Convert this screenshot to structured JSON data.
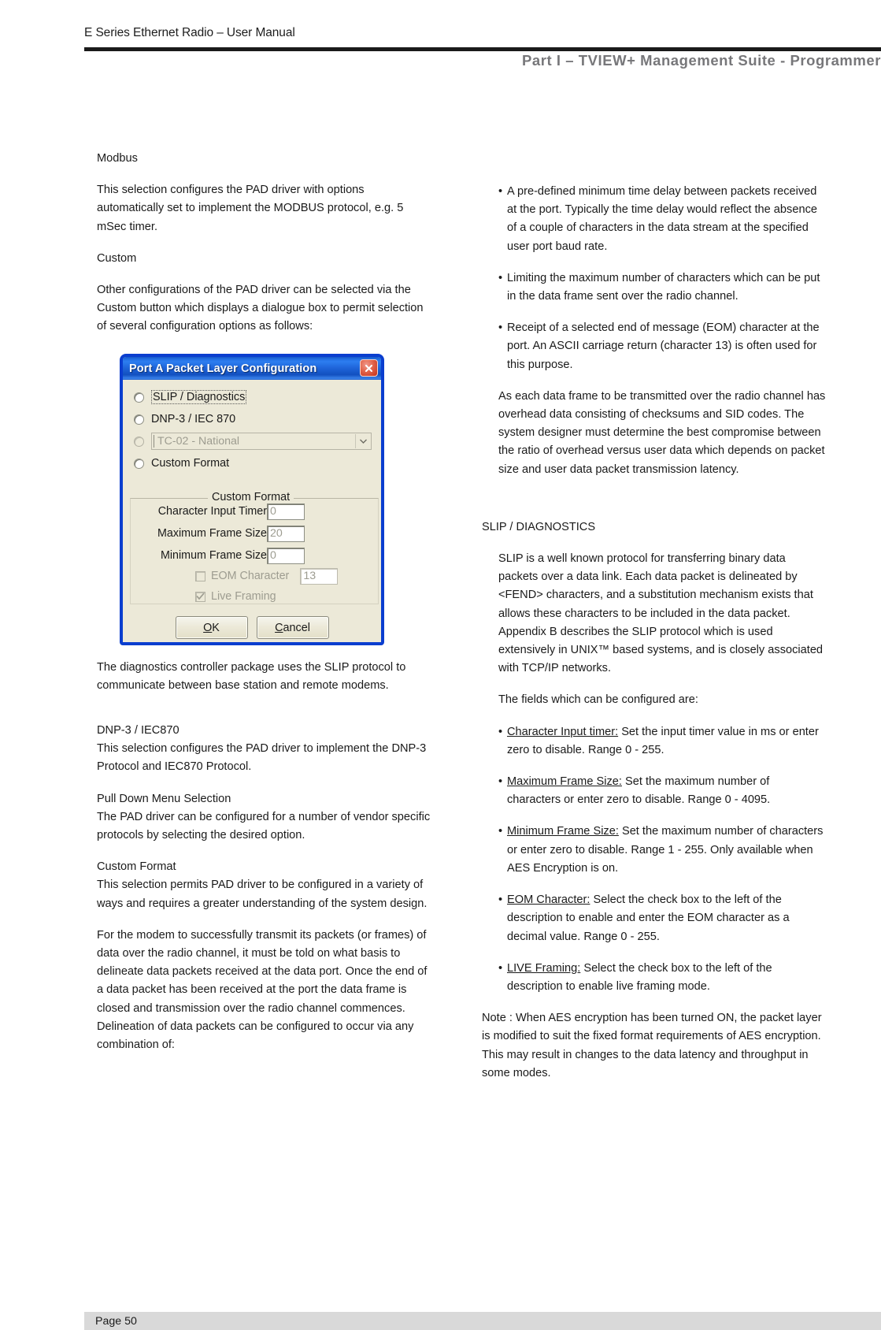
{
  "header": {
    "manual_title": "E Series Ethernet Radio – User Manual",
    "part_title": "Part I – TVIEW+ Management Suite - Programmer"
  },
  "footer": {
    "page_label": "Page 50"
  },
  "left_column": {
    "modbus_heading": "Modbus",
    "modbus_body": "This selection configures the PAD driver with options automatically set to implement the MODBUS protocol, e.g. 5 mSec timer.",
    "custom_heading": "Custom",
    "custom_body": "Other configurations of the PAD driver can be selected via the Custom button which displays a dialogue box to permit selection of several configuration options as follows:",
    "diagnostics_body": "The diagnostics controller package uses the SLIP protocol to communicate between base station and remote modems.",
    "dnp3_heading": "DNP-3 / IEC870",
    "dnp3_body": "This selection configures the PAD driver to implement the DNP-3 Protocol and IEC870 Protocol.",
    "pulldown_heading": "Pull Down Menu Selection",
    "pulldown_body": "The PAD driver can be configured for a number of vendor specific protocols by selecting the desired option.",
    "customformat_heading": "Custom Format",
    "customformat_body": "This selection permits PAD driver to be configured in a variety of ways and requires a greater understanding of the system design.",
    "modem_body": "For the modem to successfully transmit its packets (or frames) of data over the radio channel, it must be told on what basis to delineate data packets received at the data port. Once the end of a data packet has been received at the port the data frame is closed and transmission over the radio channel commences. Delineation of data packets can be configured to occur via any combination of:"
  },
  "dialog": {
    "title": "Port A Packet Layer Configuration",
    "close_icon": "close-icon",
    "radio_options": [
      {
        "label": "SLIP / Diagnostics",
        "focused": true,
        "disabled": false
      },
      {
        "label": "DNP-3 / IEC 870",
        "focused": false,
        "disabled": false
      },
      {
        "label": "",
        "focused": false,
        "disabled": true,
        "is_combo": true,
        "combo_value": "TC-02 - National"
      },
      {
        "label": "Custom Format",
        "focused": false,
        "disabled": false
      }
    ],
    "group_legend": "Custom Format",
    "fields": [
      {
        "label": "Character Input Timer",
        "value": "0",
        "disabled": false
      },
      {
        "label": "Maximum Frame Size",
        "value": "20",
        "disabled": false
      },
      {
        "label": "Minimum Frame Size",
        "value": "0",
        "disabled": false
      }
    ],
    "eom_checkbox_label": "EOM Character",
    "eom_value": "13",
    "eom_checked": false,
    "live_framing_label": "Live Framing",
    "live_framing_checked": true,
    "ok_label": "OK",
    "ok_accel": "O",
    "ok_rest": "K",
    "cancel_accel": "C",
    "cancel_rest": "ancel",
    "accent_title_color": "#1f6bdf",
    "face_color": "#ece9d8"
  },
  "right_column": {
    "bullets_top": [
      "A pre-defined minimum time delay between packets received at the port. Typically the time delay would reflect the absence of a couple of characters in the data stream at the specified user port baud rate.",
      "Limiting the maximum number of characters which can be put in the data frame sent over the radio channel.",
      "Receipt of a selected end of message (EOM) character at the port. An ASCII carriage return (character 13) is often used for this purpose."
    ],
    "overhead_body": "As each data frame to be transmitted over the radio channel has overhead data consisting of checksums and SID codes. The system designer must determine the best compromise between the ratio of overhead versus user data which depends on packet size and user data packet transmission latency.",
    "slip_heading": "SLIP / DIAGNOSTICS",
    "slip_body": "SLIP is a well known protocol for transferring binary data packets over a data link. Each data packet is delineated by <FEND> characters, and a substitution mechanism exists that allows these characters to be included in the data packet. Appendix B describes the SLIP protocol which is used extensively in UNIX™ based systems, and is closely associated with TCP/IP networks.",
    "fields_intro": "The fields which can be configured are:",
    "field_bullets": [
      {
        "term": "Character Input timer:",
        "desc": " Set the input timer value in ms or enter zero to disable.  Range 0 - 255."
      },
      {
        "term": "Maximum Frame Size:",
        "desc": " Set the maximum number of characters or enter zero to disable.  Range 0 - 4095."
      },
      {
        "term": "Minimum Frame Size:",
        "desc": " Set the maximum number of characters or enter zero to disable.  Range 1 - 255. Only available when AES Encryption is on."
      },
      {
        "term": "EOM Character:",
        "desc": " Select the check box to the left of the description to enable and enter the EOM character as a decimal value.  Range 0 - 255."
      },
      {
        "term": "LIVE Framing:",
        "desc": " Select the check box to the left of the description to enable live framing mode."
      }
    ],
    "note_body": "Note : When AES encryption has been turned ON, the packet layer is modified to suit the fixed format requirements of AES encryption. This may result in changes to the data latency and throughput in some modes."
  }
}
